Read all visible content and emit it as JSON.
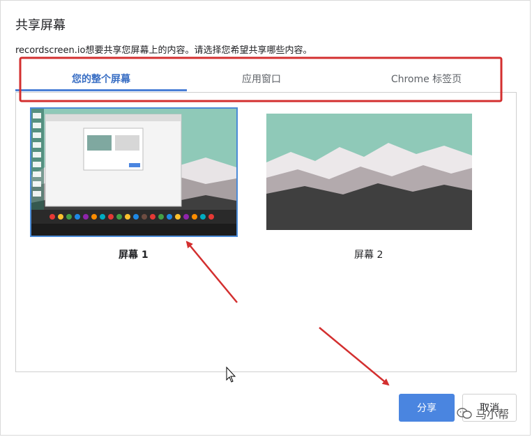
{
  "dialog": {
    "title": "共享屏幕",
    "subtitle": "recordscreen.io想要共享您屏幕上的内容。请选择您希望共享哪些内容。"
  },
  "tabs": [
    {
      "label": "您的整个屏幕",
      "active": true
    },
    {
      "label": "应用窗口",
      "active": false
    },
    {
      "label": "Chrome 标签页",
      "active": false
    }
  ],
  "screens": [
    {
      "label": "屏幕 1",
      "selected": true
    },
    {
      "label": "屏幕 2",
      "selected": false
    }
  ],
  "buttons": {
    "share": "分享",
    "cancel": "取消"
  },
  "watermark": "马小帮",
  "colors": {
    "accent": "#4a85e0",
    "annotation_red": "#d32f2f",
    "sky": "#8fc9b8",
    "mountain_dark": "#3f3f3f"
  }
}
